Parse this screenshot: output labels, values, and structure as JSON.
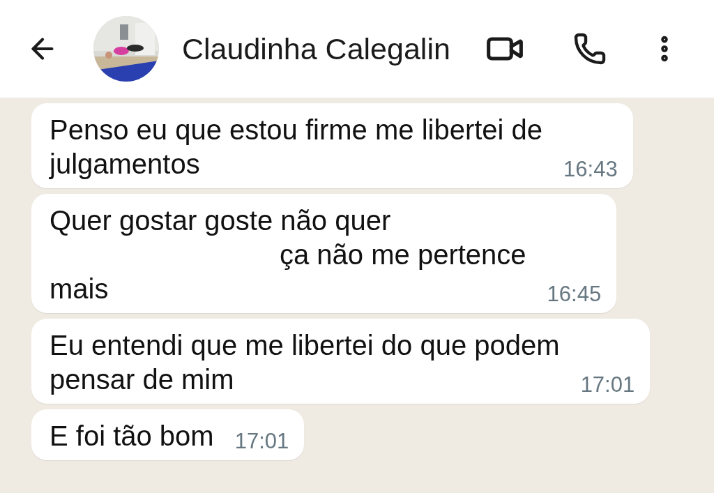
{
  "header": {
    "contact_name": "Claudinha Calegalin"
  },
  "messages": [
    {
      "lines": [
        {
          "text": "Penso eu que estou firme me libertei de",
          "redacted_before": false,
          "redacted_after": false
        },
        {
          "text": "julgamentos",
          "redacted_before": false,
          "redacted_after": false
        }
      ],
      "time": "16:43"
    },
    {
      "lines": [
        {
          "text": "Quer gostar goste não quer",
          "redacted_before": false,
          "redacted_after": true
        },
        {
          "text": "ça não me pertence",
          "redacted_before": true,
          "redacted_after": false
        },
        {
          "text": "mais",
          "redacted_before": false,
          "redacted_after": false
        }
      ],
      "time": "16:45"
    },
    {
      "lines": [
        {
          "text": "Eu entendi que me libertei do que podem",
          "redacted_before": false,
          "redacted_after": false
        },
        {
          "text": "pensar de mim",
          "redacted_before": false,
          "redacted_after": false
        }
      ],
      "time": "17:01"
    },
    {
      "lines": [
        {
          "text": "E foi tão bom",
          "redacted_before": false,
          "redacted_after": false
        }
      ],
      "time": "17:01"
    }
  ]
}
